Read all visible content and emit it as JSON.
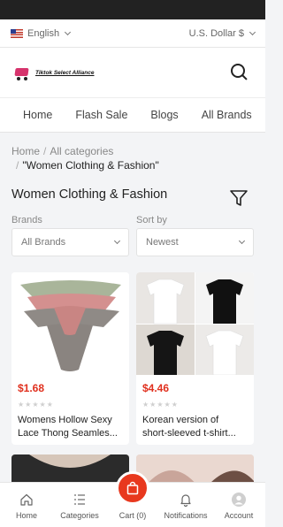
{
  "topbar": {
    "language": "English",
    "currency": "U.S. Dollar $"
  },
  "header": {
    "logo_text": "Tiktok Select Alliance"
  },
  "nav_tabs": [
    "Home",
    "Flash Sale",
    "Blogs",
    "All Brands"
  ],
  "breadcrumb": {
    "home": "Home",
    "categories": "All categories",
    "current": "\"Women Clothing & Fashion\""
  },
  "page_title": "Women Clothing & Fashion",
  "filters": {
    "brands_label": "Brands",
    "brands_value": "All Brands",
    "sort_label": "Sort by",
    "sort_value": "Newest"
  },
  "products": [
    {
      "price": "$1.68",
      "name_line1": "Womens Hollow Sexy",
      "name_line2": "Lace Thong Seamles...",
      "rating": 0
    },
    {
      "price": "$4.46",
      "name_line1": "Korean version of",
      "name_line2": "short-sleeved t-shirt...",
      "rating": 0
    }
  ],
  "bottom_nav": {
    "home": "Home",
    "categories": "Categories",
    "cart": "Cart (0)",
    "notifications": "Notifications",
    "account": "Account"
  },
  "colors": {
    "accent": "#e8381e",
    "price": "#e0301e"
  }
}
